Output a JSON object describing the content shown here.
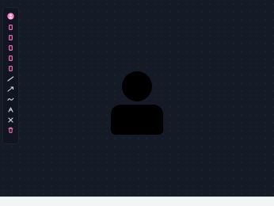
{
  "window": {
    "background": "#141a26",
    "status_bar_color": "#f3f4f6"
  },
  "toolbar": {
    "accent": "#ff7ac1",
    "muted": "#d8d8e6",
    "items": [
      {
        "name": "profile-icon"
      },
      {
        "name": "rectangle-icon"
      },
      {
        "name": "rectangle-icon"
      },
      {
        "name": "rectangle-icon"
      },
      {
        "name": "rectangle-icon"
      },
      {
        "name": "rectangle-icon"
      },
      {
        "name": "line-icon"
      },
      {
        "name": "arrow-icon"
      },
      {
        "name": "freehand-icon"
      },
      {
        "name": "text-icon"
      },
      {
        "name": "close-icon"
      },
      {
        "name": "trash-icon"
      }
    ]
  },
  "canvas": {
    "placeholder_icon": "user-silhouette-icon"
  }
}
